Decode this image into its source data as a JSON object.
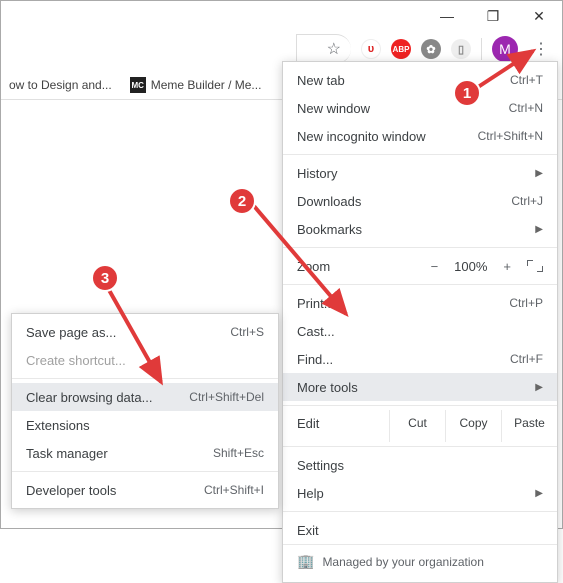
{
  "window": {
    "min": "—",
    "max": "❐",
    "close": "✕"
  },
  "toolbar": {
    "star": "☆",
    "ext_ublock": "ᴜ",
    "ext_abp": "ABP",
    "avatar_letter": "M",
    "kebab": "⋮"
  },
  "bookmarks": {
    "b1": "ow to Design and...",
    "b2_badge": "MC",
    "b2": "Meme Builder / Me..."
  },
  "mainMenu": {
    "newTab": {
      "label": "New tab",
      "shortcut": "Ctrl+T"
    },
    "newWindow": {
      "label": "New window",
      "shortcut": "Ctrl+N"
    },
    "newIncognito": {
      "label": "New incognito window",
      "shortcut": "Ctrl+Shift+N"
    },
    "history": {
      "label": "History"
    },
    "downloads": {
      "label": "Downloads",
      "shortcut": "Ctrl+J"
    },
    "bookmarks": {
      "label": "Bookmarks"
    },
    "zoom": {
      "label": "Zoom",
      "minus": "−",
      "value": "100%",
      "plus": "+"
    },
    "print": {
      "label": "Print...",
      "shortcut": "Ctrl+P"
    },
    "cast": {
      "label": "Cast..."
    },
    "find": {
      "label": "Find...",
      "shortcut": "Ctrl+F"
    },
    "moreTools": {
      "label": "More tools"
    },
    "edit": {
      "label": "Edit",
      "cut": "Cut",
      "copy": "Copy",
      "paste": "Paste"
    },
    "settings": {
      "label": "Settings"
    },
    "help": {
      "label": "Help"
    },
    "exit": {
      "label": "Exit"
    },
    "managed": "Managed by your organization"
  },
  "subMenu": {
    "savePage": {
      "label": "Save page as...",
      "shortcut": "Ctrl+S"
    },
    "createShortcut": {
      "label": "Create shortcut..."
    },
    "clearData": {
      "label": "Clear browsing data...",
      "shortcut": "Ctrl+Shift+Del"
    },
    "extensions": {
      "label": "Extensions"
    },
    "taskManager": {
      "label": "Task manager",
      "shortcut": "Shift+Esc"
    },
    "devTools": {
      "label": "Developer tools",
      "shortcut": "Ctrl+Shift+I"
    }
  },
  "badges": {
    "b1": "1",
    "b2": "2",
    "b3": "3"
  }
}
